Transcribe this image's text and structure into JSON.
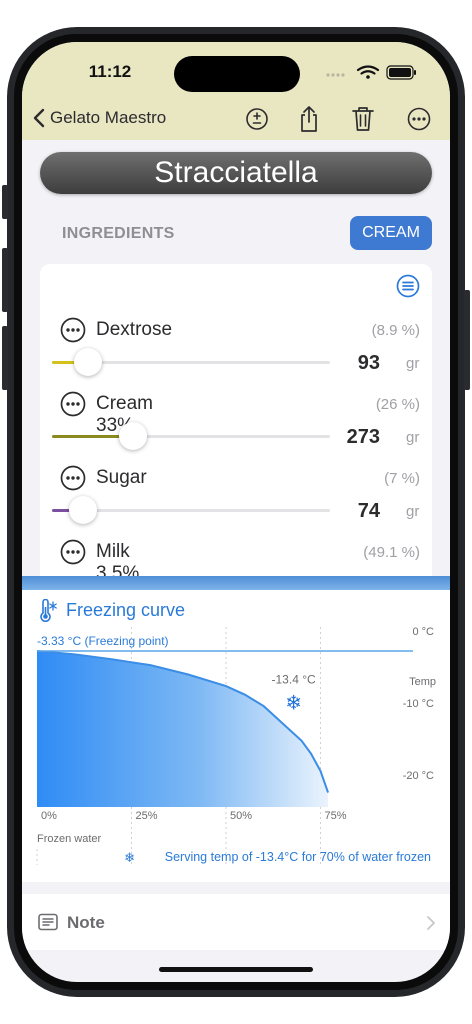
{
  "status_bar": {
    "time": "11:12"
  },
  "nav": {
    "back_label": "Gelato Maestro"
  },
  "recipe": {
    "title": "Stracciatella"
  },
  "ingredients": {
    "heading": "INGREDIENTS",
    "mode_button": "CREAM",
    "items": [
      {
        "name": "Dextrose",
        "percent": "(8.9 %)",
        "amount": "93",
        "unit": "gr",
        "slider_fraction": 0.13,
        "color": "#d4c11c"
      },
      {
        "name": "Cream 33%",
        "percent": "(26 %)",
        "amount": "273",
        "unit": "gr",
        "slider_fraction": 0.29,
        "color": "#8a8a1e"
      },
      {
        "name": "Sugar",
        "percent": "(7 %)",
        "amount": "74",
        "unit": "gr",
        "slider_fraction": 0.11,
        "color": "#7a4fa0"
      },
      {
        "name": "Milk 3.5%",
        "percent": "(49.1 %)"
      }
    ]
  },
  "freezing": {
    "title": "Freezing curve",
    "caption": "Serving temp of -13.4°C for 70% of water frozen"
  },
  "chart_data": {
    "type": "area",
    "x": [
      0,
      10,
      20,
      30,
      40,
      50,
      55,
      60,
      65,
      70,
      72.5,
      75,
      77
    ],
    "y": [
      -3.33,
      -3.8,
      -4.5,
      -5.3,
      -6.6,
      -8.2,
      -9.4,
      -11,
      -13.4,
      -15.8,
      -17.6,
      -20,
      -23
    ],
    "xlabel": "Frozen water",
    "ylabel": "Temp",
    "x_ticks": [
      "0%",
      "25%",
      "50%",
      "75%"
    ],
    "y_ticks": [
      "0 °C",
      "-10 °C",
      "-20 °C"
    ],
    "xlim": [
      0,
      100
    ],
    "ylim": [
      -25,
      0
    ],
    "grid": true,
    "freezing_point": {
      "value": -3.33,
      "label": "-3.33 °C (Freezing point)"
    },
    "marker": {
      "x": 70,
      "y": -13.4,
      "label": "-13.4 °C"
    }
  },
  "note": {
    "label": "Note"
  },
  "colors": {
    "accent": "#2a7ad8",
    "button": "#3f7ad2",
    "header": "#e9e6c2"
  }
}
